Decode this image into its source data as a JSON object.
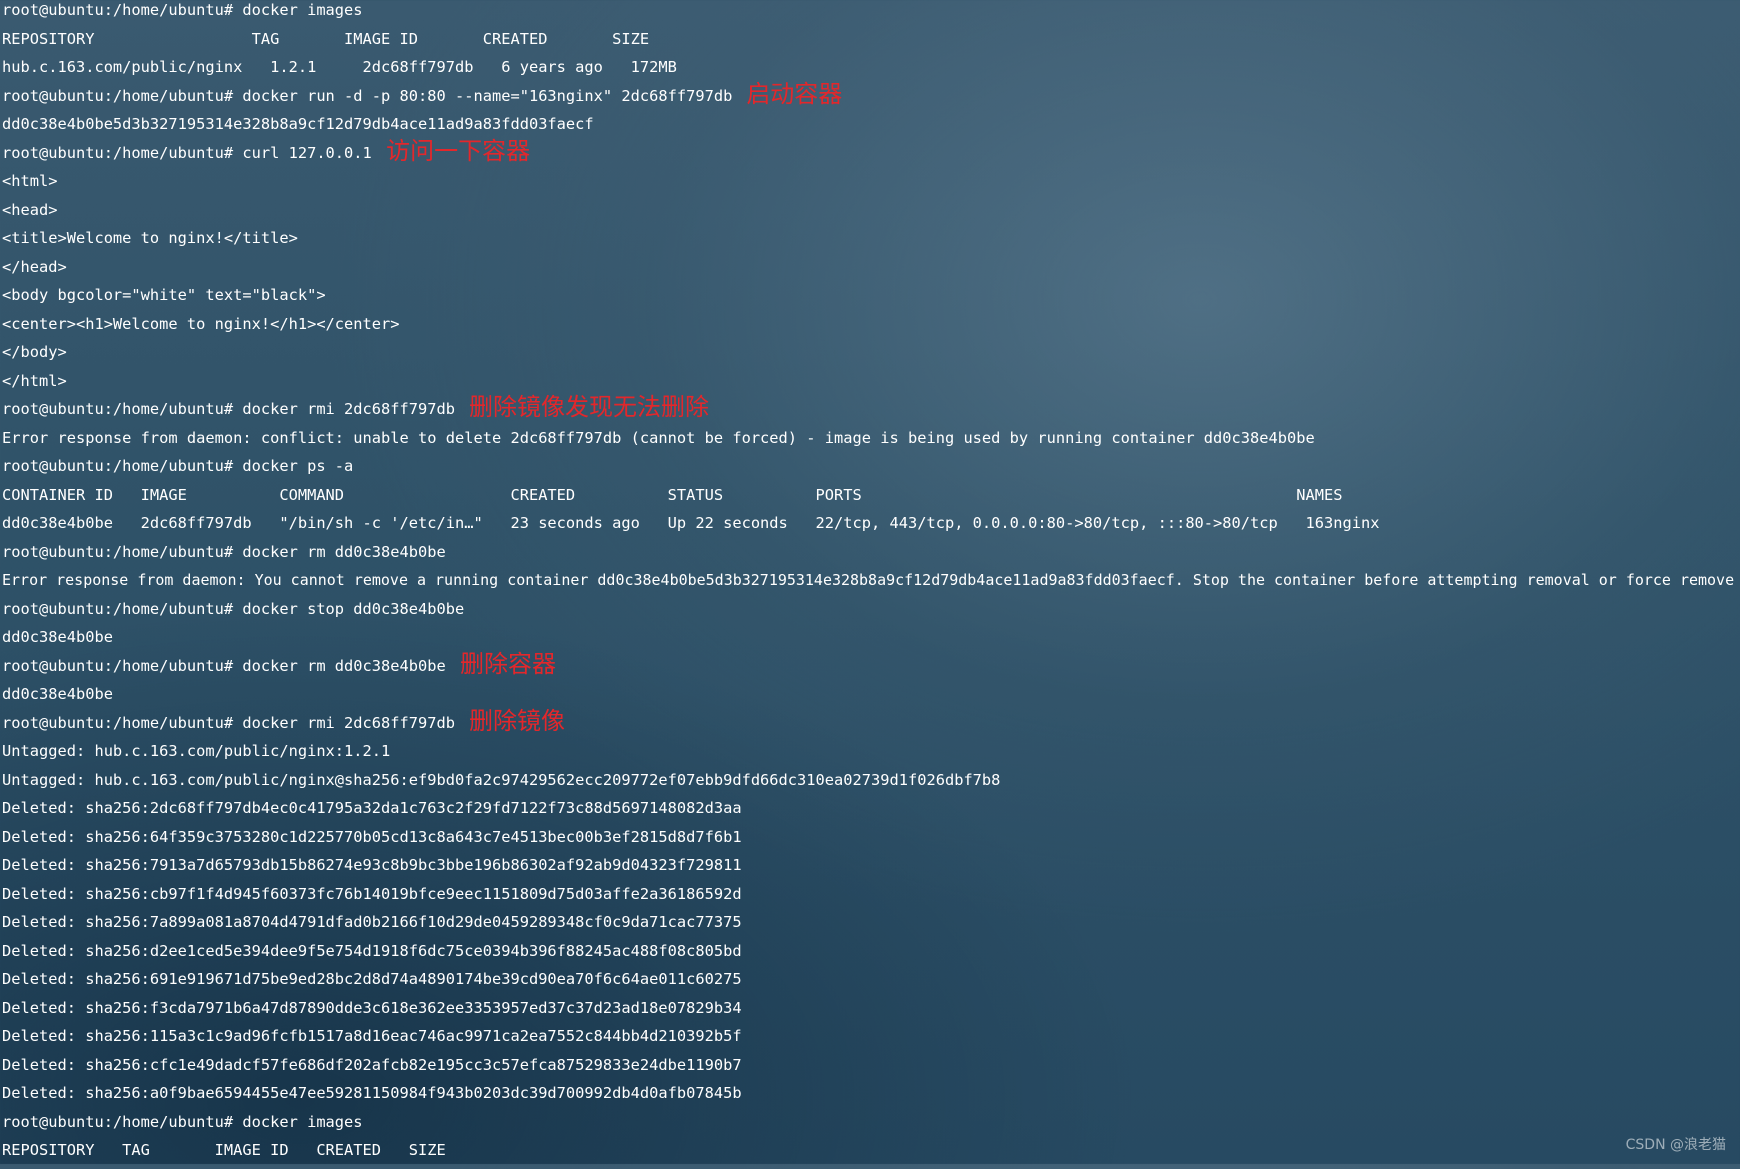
{
  "terminal": {
    "lines": [
      {
        "text": "root@ubuntu:/home/ubuntu# docker images"
      },
      {
        "text": "REPOSITORY                 TAG       IMAGE ID       CREATED       SIZE"
      },
      {
        "text": "hub.c.163.com/public/nginx   1.2.1     2dc68ff797db   6 years ago   172MB"
      },
      {
        "text": "root@ubuntu:/home/ubuntu# docker run -d -p 80:80 --name=\"163nginx\" 2dc68ff797db",
        "annotation": "启动容器"
      },
      {
        "text": "dd0c38e4b0be5d3b327195314e328b8a9cf12d79db4ace11ad9a83fdd03faecf"
      },
      {
        "text": "root@ubuntu:/home/ubuntu# curl 127.0.0.1",
        "annotation": "访问一下容器"
      },
      {
        "text": "<html>"
      },
      {
        "text": "<head>"
      },
      {
        "text": "<title>Welcome to nginx!</title>"
      },
      {
        "text": "</head>"
      },
      {
        "text": "<body bgcolor=\"white\" text=\"black\">"
      },
      {
        "text": "<center><h1>Welcome to nginx!</h1></center>"
      },
      {
        "text": "</body>"
      },
      {
        "text": "</html>"
      },
      {
        "text": "root@ubuntu:/home/ubuntu# docker rmi 2dc68ff797db",
        "annotation": "删除镜像发现无法删除"
      },
      {
        "text": "Error response from daemon: conflict: unable to delete 2dc68ff797db (cannot be forced) - image is being used by running container dd0c38e4b0be"
      },
      {
        "text": "root@ubuntu:/home/ubuntu# docker ps -a"
      },
      {
        "text": "CONTAINER ID   IMAGE          COMMAND                  CREATED          STATUS          PORTS                                               NAMES"
      },
      {
        "text": "dd0c38e4b0be   2dc68ff797db   \"/bin/sh -c '/etc/in…\"   23 seconds ago   Up 22 seconds   22/tcp, 443/tcp, 0.0.0.0:80->80/tcp, :::80->80/tcp   163nginx"
      },
      {
        "text": "root@ubuntu:/home/ubuntu# docker rm dd0c38e4b0be"
      },
      {
        "text": "Error response from daemon: You cannot remove a running container dd0c38e4b0be5d3b327195314e328b8a9cf12d79db4ace11ad9a83fdd03faecf. Stop the container before attempting removal or force remove"
      },
      {
        "text": "root@ubuntu:/home/ubuntu# docker stop dd0c38e4b0be"
      },
      {
        "text": "dd0c38e4b0be"
      },
      {
        "text": "root@ubuntu:/home/ubuntu# docker rm dd0c38e4b0be",
        "annotation": "删除容器"
      },
      {
        "text": "dd0c38e4b0be"
      },
      {
        "text": "root@ubuntu:/home/ubuntu# docker rmi 2dc68ff797db",
        "annotation": "删除镜像"
      },
      {
        "text": "Untagged: hub.c.163.com/public/nginx:1.2.1"
      },
      {
        "text": "Untagged: hub.c.163.com/public/nginx@sha256:ef9bd0fa2c97429562ecc209772ef07ebb9dfd66dc310ea02739d1f026dbf7b8"
      },
      {
        "text": "Deleted: sha256:2dc68ff797db4ec0c41795a32da1c763c2f29fd7122f73c88d5697148082d3aa"
      },
      {
        "text": "Deleted: sha256:64f359c3753280c1d225770b05cd13c8a643c7e4513bec00b3ef2815d8d7f6b1"
      },
      {
        "text": "Deleted: sha256:7913a7d65793db15b86274e93c8b9bc3bbe196b86302af92ab9d04323f729811"
      },
      {
        "text": "Deleted: sha256:cb97f1f4d945f60373fc76b14019bfce9eec1151809d75d03affe2a36186592d"
      },
      {
        "text": "Deleted: sha256:7a899a081a8704d4791dfad0b2166f10d29de0459289348cf0c9da71cac77375"
      },
      {
        "text": "Deleted: sha256:d2ee1ced5e394dee9f5e754d1918f6dc75ce0394b396f88245ac488f08c805bd"
      },
      {
        "text": "Deleted: sha256:691e919671d75be9ed28bc2d8d74a4890174be39cd90ea70f6c64ae011c60275"
      },
      {
        "text": "Deleted: sha256:f3cda7971b6a47d87890dde3c618e362ee3353957ed37c37d23ad18e07829b34"
      },
      {
        "text": "Deleted: sha256:115a3c1c9ad96fcfb1517a8d16eac746ac9971ca2ea7552c844bb4d210392b5f"
      },
      {
        "text": "Deleted: sha256:cfc1e49dadcf57fe686df202afcb82e195cc3c57efca87529833e24dbe1190b7"
      },
      {
        "text": "Deleted: sha256:a0f9bae6594455e47ee59281150984f943b0203dc39d700992db4d0afb07845b"
      },
      {
        "text": "root@ubuntu:/home/ubuntu# docker images"
      },
      {
        "text": "REPOSITORY   TAG       IMAGE ID   CREATED   SIZE"
      }
    ]
  },
  "watermark": "CSDN @浪老猫",
  "colors": {
    "text": "#ffffff",
    "annotation": "#e3272b",
    "background": "#2e5066"
  }
}
